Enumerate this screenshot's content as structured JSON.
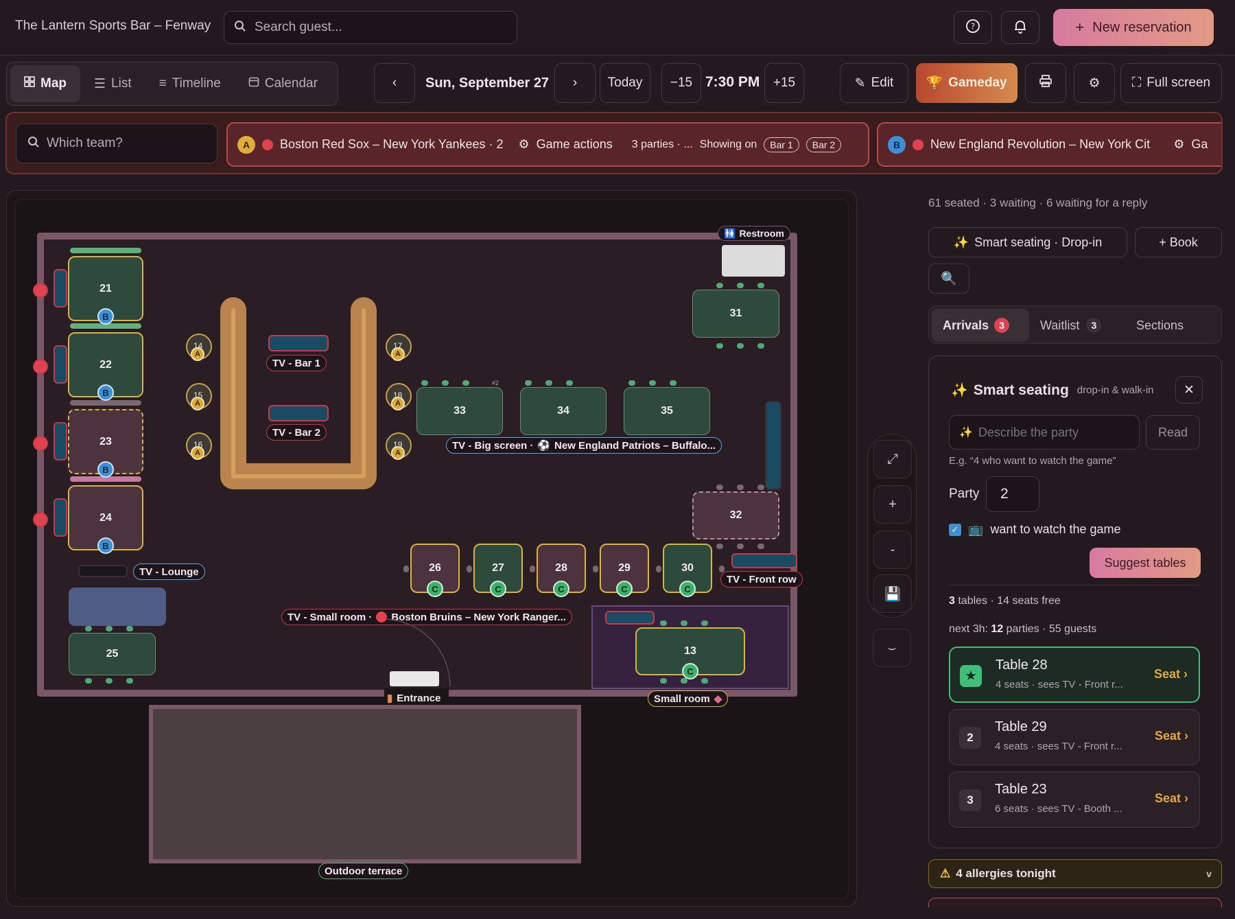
{
  "header": {
    "venue": "The Lantern Sports Bar – Fenway",
    "search_placeholder": "Search guest...",
    "new_reservation": "New reservation"
  },
  "views": [
    "Map",
    "List",
    "Timeline",
    "Calendar"
  ],
  "toolbar": {
    "date": "Sun, September 27",
    "today": "Today",
    "minus": "−15",
    "time": "7:30 PM",
    "plus": "+15",
    "edit": "Edit",
    "gameday": "Gameday",
    "fullscreen": "Full screen"
  },
  "games": {
    "team_placeholder": "Which team?",
    "game_a": {
      "letter": "A",
      "title": "Boston Red Sox – New York Yankees · 2",
      "actions": "Game actions",
      "parties": "3 parties · ...",
      "showing_on": "Showing on",
      "screens": [
        "Bar 1",
        "Bar 2"
      ]
    },
    "game_b": {
      "letter": "B",
      "title": "New England Revolution – New York Cit",
      "actions": "Ga"
    }
  },
  "map": {
    "restroom": "Restroom",
    "entrance": "Entrance",
    "outdoor": "Outdoor terrace",
    "small_room": "Small room",
    "tv_lounge": "TV - Lounge",
    "tv_bar1": "TV - Bar 1",
    "tv_bar2": "TV - Bar 2",
    "tv_big": "TV - Big screen · ",
    "tv_big_game": "New England Patriots – Buffalo...",
    "tv_front": "TV - Front row",
    "tv_small": "TV - Small room · ",
    "tv_small_game": "Boston Bruins – New York Ranger...",
    "tables": {
      "t21": "21",
      "t22": "22",
      "t23": "23",
      "t24": "24",
      "t25": "25",
      "t31": "31",
      "t32": "32",
      "t33": "33",
      "t34": "34",
      "t35": "35",
      "t26": "26",
      "t27": "27",
      "t28": "28",
      "t29": "29",
      "t30": "30",
      "t13": "13",
      "s14": "14",
      "s15": "15",
      "s16": "16",
      "s17": "17",
      "s18": "18",
      "s19": "19"
    },
    "badges": {
      "b": "B",
      "c": "C",
      "a": "A"
    },
    "big_tag": "#2"
  },
  "sidebar": {
    "status": "61 seated · 3 waiting · 6 waiting for a reply",
    "smart_dropin": "Smart seating · Drop-in",
    "book": "+ Book",
    "tabs": {
      "arrivals": "Arrivals",
      "arrivals_count": "3",
      "waitlist": "Waitlist",
      "waitlist_count": "3",
      "sections": "Sections"
    },
    "smart": {
      "title": "Smart seating",
      "subtitle": "drop-in & walk-in",
      "describe_placeholder": "Describe the party",
      "read": "Read",
      "hint": "E.g. “4 who want to watch the game”",
      "party_label": "Party",
      "party_value": "2",
      "watch": "want to watch the game",
      "suggest": "Suggest tables",
      "tables_count": "3",
      "tables_text": " tables · 14 seats free",
      "next_prefix": "next 3h: ",
      "next_parties": "12",
      "next_suffix": " parties · 55 guests"
    },
    "suggestions": [
      {
        "rank": "★",
        "name": "Table 28",
        "desc": "4 seats · sees TV - Front r...",
        "action": "Seat ›"
      },
      {
        "rank": "2",
        "name": "Table 29",
        "desc": "4 seats · sees TV - Front r...",
        "action": "Seat ›"
      },
      {
        "rank": "3",
        "name": "Table 23",
        "desc": "6 seats · sees TV - Booth ...",
        "action": "Seat ›"
      }
    ],
    "allergies": "4 allergies tonight"
  }
}
